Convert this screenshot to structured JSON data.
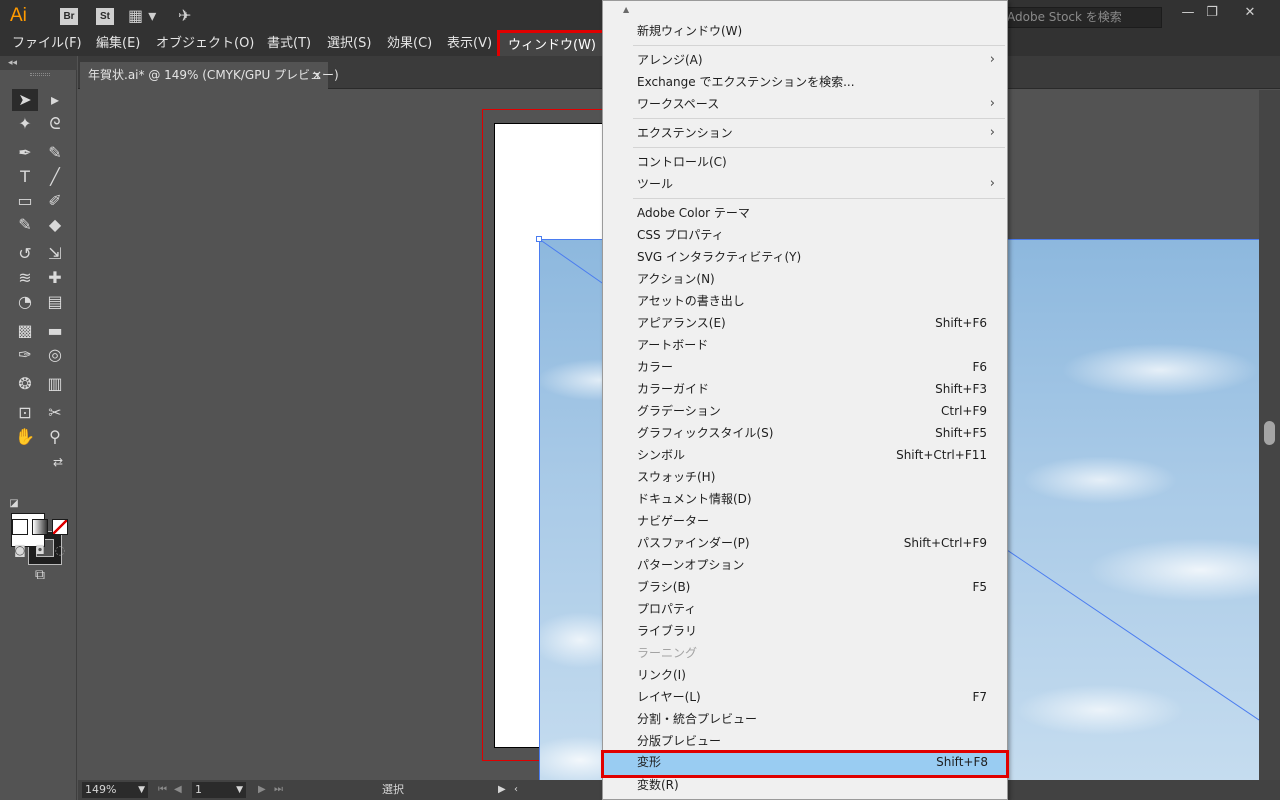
{
  "app": {
    "logo": "Ai",
    "bridge": "Br",
    "stock": "St",
    "stock_search_placeholder": "Adobe Stock を検索",
    "window_controls": {
      "minimize": "—",
      "restore": "❐",
      "close": "✕"
    }
  },
  "menubar": [
    "ファイル(F)",
    "編集(E)",
    "オブジェクト(O)",
    "書式(T)",
    "選択(S)",
    "効果(C)",
    "表示(V)",
    "ウィンドウ(W)"
  ],
  "document_tab": {
    "title": "年賀状.ai* @ 149% (CMYK/GPU プレビュー)",
    "close": "×"
  },
  "statusbar": {
    "zoom": "149%",
    "page": "1",
    "tool": "選択"
  },
  "toolbox": {
    "collapse": "◂◂"
  },
  "window_menu": [
    {
      "label": "新規ウィンドウ(W)"
    },
    {
      "sep": true
    },
    {
      "label": "アレンジ(A)",
      "submenu": true
    },
    {
      "label": "Exchange でエクステンションを検索..."
    },
    {
      "label": "ワークスペース",
      "submenu": true
    },
    {
      "sep": true
    },
    {
      "label": "エクステンション",
      "submenu": true
    },
    {
      "sep": true
    },
    {
      "label": "コントロール(C)"
    },
    {
      "label": "ツール",
      "submenu": true
    },
    {
      "sep": true
    },
    {
      "label": "Adobe Color テーマ"
    },
    {
      "label": "CSS プロパティ"
    },
    {
      "label": "SVG インタラクティビティ(Y)"
    },
    {
      "label": "アクション(N)"
    },
    {
      "label": "アセットの書き出し"
    },
    {
      "label": "アピアランス(E)",
      "shortcut": "Shift+F6"
    },
    {
      "label": "アートボード"
    },
    {
      "label": "カラー",
      "shortcut": "F6"
    },
    {
      "label": "カラーガイド",
      "shortcut": "Shift+F3"
    },
    {
      "label": "グラデーション",
      "shortcut": "Ctrl+F9"
    },
    {
      "label": "グラフィックスタイル(S)",
      "shortcut": "Shift+F5"
    },
    {
      "label": "シンボル",
      "shortcut": "Shift+Ctrl+F11"
    },
    {
      "label": "スウォッチ(H)"
    },
    {
      "label": "ドキュメント情報(D)"
    },
    {
      "label": "ナビゲーター"
    },
    {
      "label": "パスファインダー(P)",
      "shortcut": "Shift+Ctrl+F9"
    },
    {
      "label": "パターンオプション"
    },
    {
      "label": "ブラシ(B)",
      "shortcut": "F5"
    },
    {
      "label": "プロパティ"
    },
    {
      "label": "ライブラリ"
    },
    {
      "label": "ラーニング",
      "disabled": true
    },
    {
      "label": "リンク(I)"
    },
    {
      "label": "レイヤー(L)",
      "shortcut": "F7"
    },
    {
      "label": "分割・統合プレビュー"
    },
    {
      "label": "分版プレビュー"
    },
    {
      "label": "変形",
      "shortcut": "Shift+F8",
      "highlighted": true
    },
    {
      "label": "変数(R)"
    }
  ],
  "colors": {
    "accent_highlight": "#99ccf2",
    "annotation_red": "#e00000",
    "logo_orange": "#ff9a00"
  }
}
